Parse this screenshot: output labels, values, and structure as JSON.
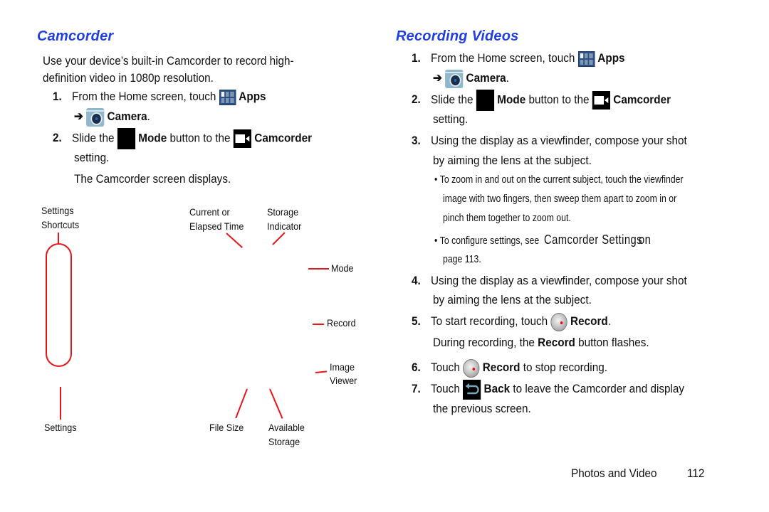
{
  "left": {
    "heading": "Camcorder",
    "intro_line1": "Use your device’s built-in Camcorder to record high-",
    "intro_line2": "definition video in 1080p resolution.",
    "steps": [
      {
        "num": "1.",
        "pre": "From the Home screen, touch",
        "bold": "Apps",
        "line2_arrow": "➔",
        "line2_bold": "Camera",
        "line2_post": "."
      },
      {
        "num": "2.",
        "pre": "Slide the",
        "bold": "Mode",
        "mid": "button to the",
        "bold2": "Camcorder",
        "line2": "setting.",
        "line3": "The Camcorder screen displays."
      }
    ],
    "diagram": {
      "settings_shortcuts_1": "Settings",
      "settings_shortcuts_2": "Shortcuts",
      "current_time_1": "Current or",
      "current_time_2": "Elapsed Time",
      "storage_ind_1": "Storage",
      "storage_ind_2": "Indicator",
      "mode": "Mode",
      "record": "Record",
      "image_viewer_1": "Image",
      "image_viewer_2": "Viewer",
      "settings": "Settings",
      "file_size": "File Size",
      "available_1": "Available",
      "available_2": "Storage"
    }
  },
  "right": {
    "heading": "Recording Videos",
    "steps": [
      {
        "num": "1.",
        "pre": "From the Home screen, touch",
        "bold": "Apps",
        "line2_arrow": "➔",
        "line2_bold": "Camera",
        "line2_post": "."
      },
      {
        "num": "2.",
        "pre": "Slide the",
        "bold": "Mode",
        "mid": "button to the",
        "bold2": "Camcorder",
        "line2": "setting."
      },
      {
        "num": "3.",
        "line1": "Using the display as a viewfinder, compose your shot",
        "line2": "by aiming the lens at the subject."
      },
      {
        "num": "4.",
        "line1": "Using the display as a viewfinder, compose your shot",
        "line2": "by aiming the lens at the subject."
      },
      {
        "num": "5.",
        "pre": "To start recording, touch",
        "bold": "Record",
        "post": ".",
        "line2_pre": "During recording, the",
        "line2_bold": "Record",
        "line2_post": "button flashes."
      },
      {
        "num": "6.",
        "pre": "Touch",
        "bold": "Record",
        "post": "to stop recording."
      },
      {
        "num": "7.",
        "pre": "Touch",
        "bold": "Back",
        "post": "to leave the Camcorder and display",
        "line2": "the previous screen."
      }
    ],
    "bullets": [
      {
        "line1": "To zoom in and out on the current subject, touch the viewfinder",
        "line2": "image with two fingers, then sweep them apart to zoom in or",
        "line3": "pinch them together to zoom out."
      },
      {
        "pre": "To configure settings, see",
        "xref": "Camcorder Settings",
        "xref_suffix": "on",
        "line2": "page 113."
      }
    ]
  },
  "footer": {
    "section": "Photos and Video",
    "page": "112"
  },
  "colors": {
    "heading": "#1f3fe0",
    "callout": "#e8141b"
  }
}
